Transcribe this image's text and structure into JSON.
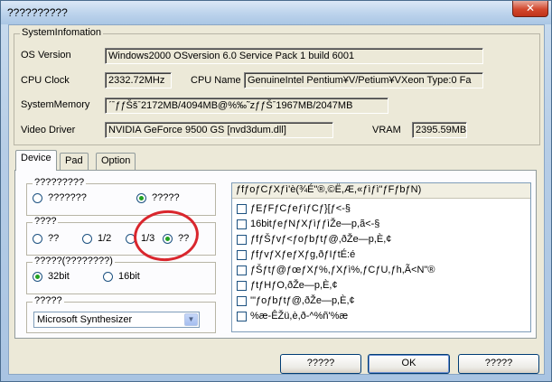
{
  "window": {
    "title": "??????????",
    "close_glyph": "✕"
  },
  "system_info": {
    "caption": "SystemInfomation",
    "os_label": "OS Version",
    "os_value": "Windows2000 OSversion 6.0 Service Pack 1 build 6001",
    "cpu_clock_label": "CPU Clock",
    "cpu_clock_value": "2332.72MHz",
    "cpu_name_label": "CPU Name",
    "cpu_name_value": "GenuineIntel Pentium¥V/Petium¥VXeon Type:0 Fa",
    "memory_label": "SystemMemory",
    "memory_value": "ˊˉƒƒŠšˉ2172MB/4094MB@%‰˜zƒƒŠˉ1967MB/2047MB",
    "video_label": "Video Driver",
    "video_value": "NVIDIA GeForce 9500 GS [nvd3dum.dll]",
    "vram_label": "VRAM",
    "vram_value": "2395.59MB"
  },
  "tabs": [
    {
      "label": "Device"
    },
    {
      "label": "Pad"
    },
    {
      "label": "Option"
    }
  ],
  "device": {
    "group1": {
      "caption": "?????????",
      "option_a": "???????",
      "option_b": "?????",
      "selected": "option_b"
    },
    "group2": {
      "caption": "????",
      "option_a": "??",
      "option_b": "1/2",
      "option_c": "1/3",
      "option_d": "??",
      "selected": "option_d"
    },
    "group3": {
      "caption": "?????(????????)",
      "option_a": "32bit",
      "option_b": "16bit",
      "selected": "option_a"
    },
    "group4": {
      "caption": "?????",
      "selected_voice": "Microsoft Synthesizer"
    },
    "list": {
      "header": "ƒfƒoƒCƒXƒì'è(¾É\"®,©Ë,Æ,«ƒìƒì\"ƒFƒbƒN)",
      "items": [
        "ƒEƒFƒCƒeƒìƒCƒ}[ƒ<-§",
        "16bitƒeƒNƒXƒìƒƒìŽe—p,ã<-§",
        "ƒfƒŠƒvƒ<ƒoƒbƒtƒ@,ðŽe—p,È,¢",
        "ƒfƒvƒXƒeƒXƒg,ðƒIƒtÉ:é",
        "ƒŠƒtƒ@ƒœƒXƒ%,ƒXƒì%,ƒCƒU,ƒh,Ã<N\"®",
        "ƒtƒHƒO,ðŽe—p,È,¢",
        "'\"ƒoƒbƒtƒ@,ðŽe—p,È,¢",
        "%æ-ÊŽü,è,ð-^%ñ'%æ"
      ]
    }
  },
  "buttons": {
    "left": "?????",
    "ok": "OK",
    "right": "?????"
  },
  "annotation_color": "#d9262d"
}
